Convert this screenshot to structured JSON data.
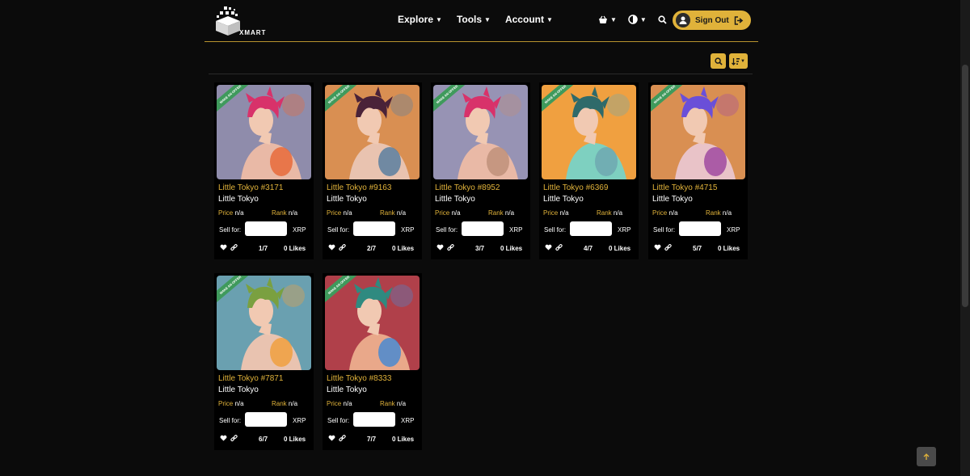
{
  "brand": {
    "logo_text": "XMART"
  },
  "nav": [
    {
      "label": "Explore"
    },
    {
      "label": "Tools"
    },
    {
      "label": "Account"
    }
  ],
  "header": {
    "signout_label": "Sign Out"
  },
  "colors": {
    "accent": "#e0b23a",
    "ribbon": "#3f9a5c",
    "background": "#0b0b0b"
  },
  "cards": [
    {
      "title": "Little Tokyo #3171",
      "collection": "Little Tokyo",
      "price_label": "Price",
      "price_value": "n/a",
      "rank_label": "Rank",
      "rank_value": "n/a",
      "sell_label": "Sell for:",
      "currency": "XRP",
      "edition": "1/7",
      "likes": "0 Likes",
      "ribbon": "MAKE AN OFFER",
      "bg": "#8f8cab",
      "hair": "#d8326a",
      "shirt": "#e9b9a6",
      "accent": "#e86a3a"
    },
    {
      "title": "Little Tokyo #9163",
      "collection": "Little Tokyo",
      "price_label": "Price",
      "price_value": "n/a",
      "rank_label": "Rank",
      "rank_value": "n/a",
      "sell_label": "Sell for:",
      "currency": "XRP",
      "edition": "2/7",
      "likes": "0 Likes",
      "ribbon": "MAKE AN OFFER",
      "bg": "#d98f52",
      "hair": "#4a2238",
      "shirt": "#e9c3b0",
      "accent": "#5a7fa0"
    },
    {
      "title": "Little Tokyo #8952",
      "collection": "Little Tokyo",
      "price_label": "Price",
      "price_value": "n/a",
      "rank_label": "Rank",
      "rank_value": "n/a",
      "sell_label": "Sell for:",
      "currency": "XRP",
      "edition": "3/7",
      "likes": "0 Likes",
      "ribbon": "MAKE AN OFFER",
      "bg": "#9793b4",
      "hair": "#d8326a",
      "shirt": "#e9b9a6",
      "accent": "#c0907a"
    },
    {
      "title": "Little Tokyo #6369",
      "collection": "Little Tokyo",
      "price_label": "Price",
      "price_value": "n/a",
      "rank_label": "Rank",
      "rank_value": "n/a",
      "sell_label": "Sell for:",
      "currency": "XRP",
      "edition": "4/7",
      "likes": "0 Likes",
      "ribbon": "MAKE AN OFFER",
      "bg": "#f0a040",
      "hair": "#2f6a6a",
      "shirt": "#7ed0c0",
      "accent": "#6fa8b0"
    },
    {
      "title": "Little Tokyo #4715",
      "collection": "Little Tokyo",
      "price_label": "Price",
      "price_value": "n/a",
      "rank_label": "Rank",
      "rank_value": "n/a",
      "sell_label": "Sell for:",
      "currency": "XRP",
      "edition": "5/7",
      "likes": "0 Likes",
      "ribbon": "MAKE AN OFFER",
      "bg": "#d98f52",
      "hair": "#6a4fd8",
      "shirt": "#e9c3c8",
      "accent": "#a04aa0"
    },
    {
      "title": "Little Tokyo #7871",
      "collection": "Little Tokyo",
      "price_label": "Price",
      "price_value": "n/a",
      "rank_label": "Rank",
      "rank_value": "n/a",
      "sell_label": "Sell for:",
      "currency": "XRP",
      "edition": "6/7",
      "likes": "0 Likes",
      "ribbon": "MAKE AN OFFER",
      "bg": "#6aa0b0",
      "hair": "#7aa040",
      "shirt": "#e9c3b0",
      "accent": "#f0a040"
    },
    {
      "title": "Little Tokyo #8333",
      "collection": "Little Tokyo",
      "price_label": "Price",
      "price_value": "n/a",
      "rank_label": "Rank",
      "rank_value": "n/a",
      "sell_label": "Sell for:",
      "currency": "XRP",
      "edition": "7/7",
      "likes": "0 Likes",
      "ribbon": "MAKE AN OFFER",
      "bg": "#b0404a",
      "hair": "#2f8a80",
      "shirt": "#e9a88a",
      "accent": "#4a8ad0"
    }
  ]
}
